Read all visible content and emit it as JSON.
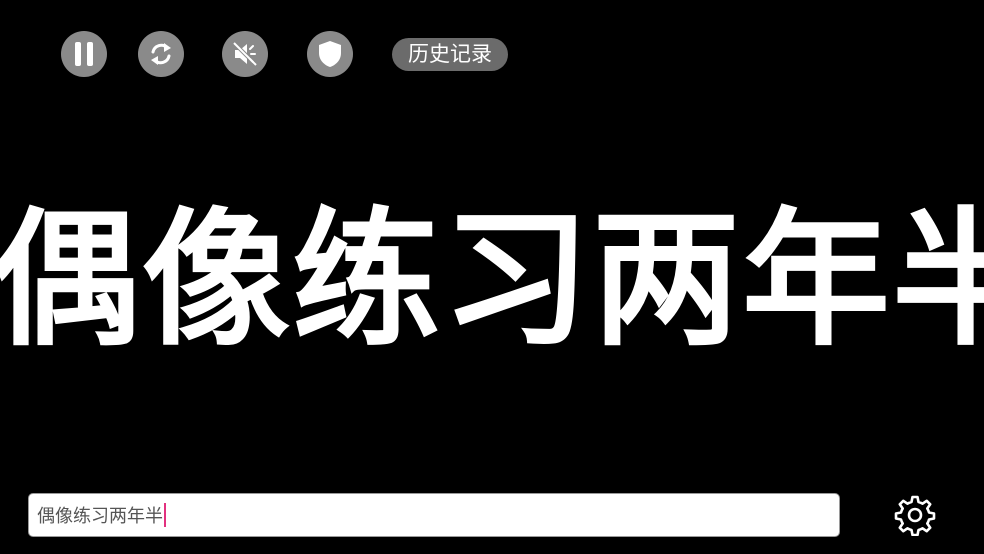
{
  "toolbar": {
    "buttons": [
      {
        "icon": "pause-icon"
      },
      {
        "icon": "repeat-icon"
      },
      {
        "icon": "mute-icon"
      },
      {
        "icon": "shield-icon"
      }
    ],
    "history_label": "历史记录"
  },
  "display": {
    "marquee_text": "偶像练习两年半"
  },
  "input": {
    "value": "偶像练习两年半"
  },
  "settings": {
    "icon": "gear-icon"
  },
  "colors": {
    "background": "#000000",
    "button_bg": "#8a8a8a",
    "history_bg": "#6b6b6b",
    "text": "#ffffff",
    "caret": "#e2317f"
  }
}
